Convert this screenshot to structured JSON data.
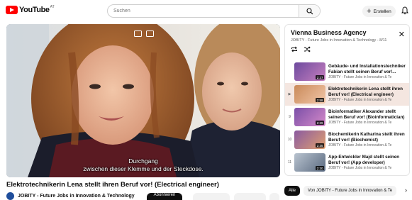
{
  "header": {
    "logo_text": "YouTube",
    "logo_region": "AT",
    "search_placeholder": "Suchen",
    "create_label": "Erstellen"
  },
  "video": {
    "subtitle_line1": "Durchgang",
    "subtitle_line2": "zwischen dieser Klemme und der Steckdose.",
    "title": "Elektrotechnikerin Lena stellt ihren Beruf vor! (Electrical engineer)",
    "channel": "JOBITY - Future Jobs in Innovation & Technology",
    "subscribe_label": "Abonnieren"
  },
  "playlist": {
    "title": "Vienna Business Agency",
    "subtitle": "JOBITY - Future Jobs in Innovation & Technology - 8/11",
    "items": [
      {
        "index": "",
        "title": "Gebäude- und Installationstechniker Fabian stellt seinen Beruf vor!...",
        "channel": "JOBITY - Future Jobs in Innovation & Te",
        "duration": "2:27",
        "active": false
      },
      {
        "index": "▶",
        "title": "Elektrotechnikerin Lena stellt ihren Beruf vor! (Electrical engineer)",
        "channel": "JOBITY - Future Jobs in Innovation & Te",
        "duration": "2:58",
        "active": true
      },
      {
        "index": "9",
        "title": "Bioinformatiker Alexander stellt seinen Beruf vor! (Bioinformatician)",
        "channel": "JOBITY - Future Jobs in Innovation & Te",
        "duration": "2:29",
        "active": false
      },
      {
        "index": "10",
        "title": "Biochemikerin Katharina stellt ihren Beruf vor! (Biochemist)",
        "channel": "JOBITY - Future Jobs in Innovation & Te",
        "duration": "2:35",
        "active": false
      },
      {
        "index": "11",
        "title": "App-Entwickler Majd stellt seinen Beruf vor! (App developer)",
        "channel": "JOBITY - Future Jobs in Innovation & Te",
        "duration": "2:30",
        "active": false
      }
    ]
  },
  "chips": [
    "Alle",
    "Von JOBITY - Future Jobs in Innovation & Te"
  ],
  "colors": {
    "brand": "#ff0000",
    "active_row": "#f4e6e0",
    "avatar": "#1f4e9c"
  }
}
